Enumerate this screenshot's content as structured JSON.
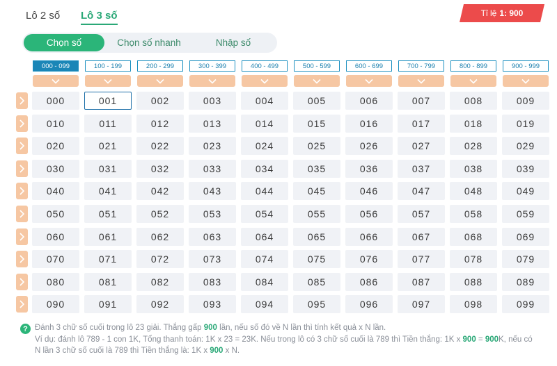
{
  "tabs": [
    {
      "label": "Lô 2 số",
      "active": false
    },
    {
      "label": "Lô 3 số",
      "active": true
    }
  ],
  "ratio": {
    "label": "Tỉ lệ",
    "value": "1: 900"
  },
  "modes": [
    "Chọn số",
    "Chọn số nhanh",
    "Nhập số"
  ],
  "ranges": [
    "000 - 099",
    "100 - 199",
    "200 - 299",
    "300 - 399",
    "400 - 499",
    "500 - 599",
    "600 - 699",
    "700 - 799",
    "800 - 899",
    "900 - 999"
  ],
  "active_range": "000 - 099",
  "numbers": [
    [
      "000",
      "001",
      "002",
      "003",
      "004",
      "005",
      "006",
      "007",
      "008",
      "009"
    ],
    [
      "010",
      "011",
      "012",
      "013",
      "014",
      "015",
      "016",
      "017",
      "018",
      "019"
    ],
    [
      "020",
      "021",
      "022",
      "023",
      "024",
      "025",
      "026",
      "027",
      "028",
      "029"
    ],
    [
      "030",
      "031",
      "032",
      "033",
      "034",
      "035",
      "036",
      "037",
      "038",
      "039"
    ],
    [
      "040",
      "041",
      "042",
      "043",
      "044",
      "045",
      "046",
      "047",
      "048",
      "049"
    ],
    [
      "050",
      "051",
      "052",
      "053",
      "054",
      "055",
      "056",
      "057",
      "058",
      "059"
    ],
    [
      "060",
      "061",
      "062",
      "063",
      "064",
      "065",
      "066",
      "067",
      "068",
      "069"
    ],
    [
      "070",
      "071",
      "072",
      "073",
      "074",
      "075",
      "076",
      "077",
      "078",
      "079"
    ],
    [
      "080",
      "081",
      "082",
      "083",
      "084",
      "085",
      "086",
      "087",
      "088",
      "089"
    ],
    [
      "090",
      "091",
      "092",
      "093",
      "094",
      "095",
      "096",
      "097",
      "098",
      "099"
    ]
  ],
  "selected_number": "001",
  "note": {
    "line1": [
      {
        "t": "Đánh 3 chữ số cuối trong lô 23 giải. Thắng gấp "
      },
      {
        "t": "900",
        "b": true
      },
      {
        "t": " lần, nếu số đó về N lần thì tính kết quả x N lần."
      }
    ],
    "line2": [
      {
        "t": "Ví dụ: đánh lô 789 - 1 con 1K, Tổng thanh toán: 1K x 23 = 23K. Nếu trong lô có 3 chữ số cuối là 789 thì Tiền thắng: 1K x "
      },
      {
        "t": "900",
        "b": true
      },
      {
        "t": " = "
      },
      {
        "t": "900",
        "b": true
      },
      {
        "t": "K, nếu có"
      }
    ],
    "line3": [
      {
        "t": "N lần 3 chữ số cuối là 789 thì Tiền thắng là: 1K x "
      },
      {
        "t": "900",
        "b": true
      },
      {
        "t": " x N."
      }
    ]
  },
  "colors": {
    "accent_green": "#2bb579",
    "accent_blue": "#1a86b7",
    "accent_peach": "#f6c7a3",
    "ratio_red": "#ec4b4b"
  }
}
